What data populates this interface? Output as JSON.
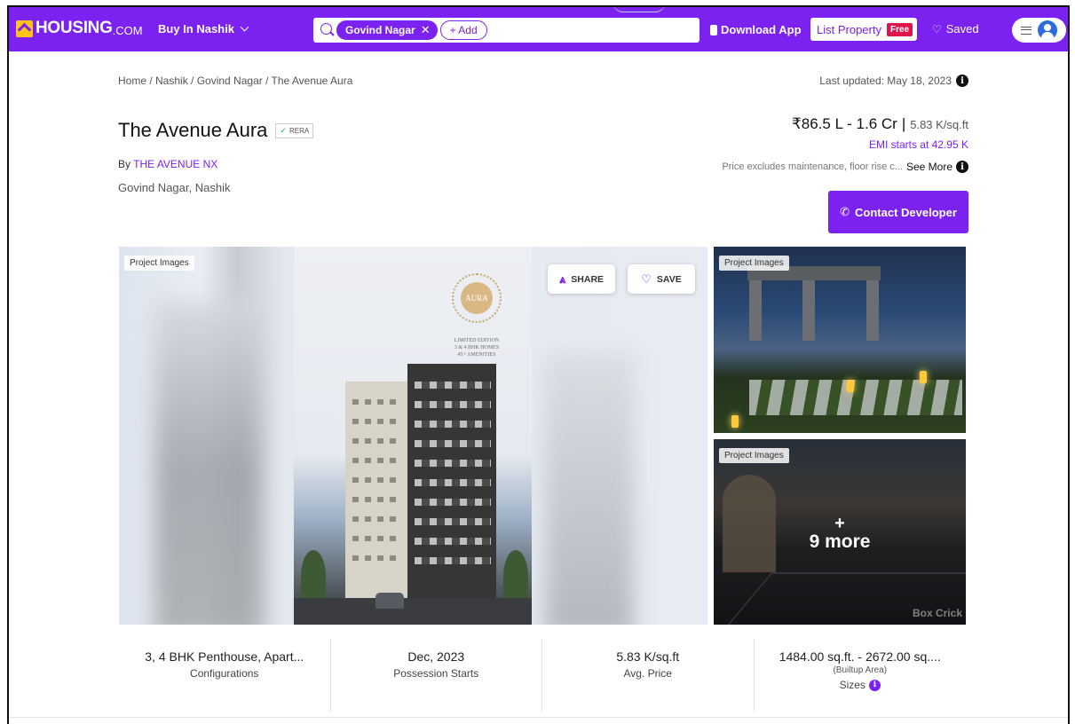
{
  "nav": {
    "logo_text": "HOUSING",
    "logo_suffix": ".COM",
    "city_label": "Buy In Nashik",
    "search_chip": "Govind Nagar",
    "search_add": "+ Add",
    "download_app": "Download App",
    "list_property": "List Property",
    "free_badge": "Free",
    "saved": "Saved"
  },
  "breadcrumb": "Home / Nashik / Govind Nagar / The Avenue Aura",
  "last_updated": "Last updated: May 18, 2023",
  "project": {
    "title": "The Avenue Aura",
    "rera": "RERA",
    "by_prefix": "By",
    "developer": "THE AVENUE NX",
    "locality": "Govind Nagar, Nashik"
  },
  "pricing": {
    "range": "₹86.5 L - 1.6 Cr",
    "separator": "|",
    "per_sqft": "5.83 K/sq.ft",
    "emi": "EMI starts at 42.95 K",
    "excludes": "Price excludes maintenance, floor rise c...",
    "see_more": "See More",
    "contact_button": "Contact Developer"
  },
  "gallery": {
    "main_tag": "Project Images",
    "share": "SHARE",
    "save": "SAVE",
    "poster_logo": "AURA",
    "poster_lines": [
      "LIMITED EDITION",
      "3 & 4 BHK HOMES",
      "45+ AMENITIES"
    ],
    "thumb1_tag": "Project Images",
    "thumb2_tag": "Project Images",
    "more_plus": "+",
    "more_label": "9 more",
    "thumb2_watermark": "Box Crick"
  },
  "stats": [
    {
      "value": "3, 4 BHK Penthouse, Apart...",
      "label": "Configurations"
    },
    {
      "value": "Dec, 2023",
      "label": "Possession Starts"
    },
    {
      "value": "5.83 K/sq.ft",
      "label": "Avg. Price"
    },
    {
      "value": "1484.00 sq.ft. - 2672.00 sq....",
      "sub": "(Builtup Area)",
      "label": "Sizes"
    }
  ],
  "colors": {
    "brand_purple": "#7b21f0",
    "logo_yellow": "#ffc21c",
    "free_red": "#e0144a"
  },
  "icons": {
    "search": "search-icon",
    "close": "close-icon",
    "phone": "phone-icon",
    "heart": "heart-icon",
    "menu": "menu-icon",
    "avatar": "user-avatar-icon",
    "info": "info-icon",
    "share": "share-icon",
    "call": "phone-call-icon",
    "check": "check-icon",
    "chevron": "chevron-down-icon"
  }
}
